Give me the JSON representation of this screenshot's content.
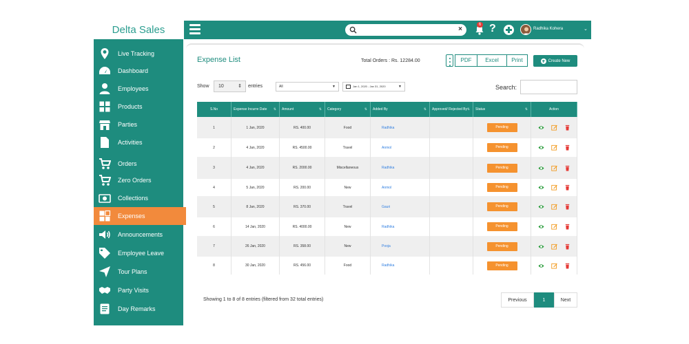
{
  "brand": "Delta Sales",
  "sidebar": {
    "items": [
      {
        "label": "Live Tracking",
        "icon": "location-pin-icon"
      },
      {
        "label": "Dashboard",
        "icon": "speedometer-icon"
      },
      {
        "label": "Employees",
        "icon": "person-icon"
      },
      {
        "label": "Products",
        "icon": "grid-icon"
      },
      {
        "label": "Parties",
        "icon": "store-icon"
      },
      {
        "label": "Activities",
        "icon": "document-icon"
      },
      {
        "label": "Orders",
        "icon": "cart-icon"
      },
      {
        "label": "Zero Orders",
        "icon": "cart-icon"
      },
      {
        "label": "Collections",
        "icon": "money-icon"
      },
      {
        "label": "Expenses",
        "icon": "expenses-icon",
        "active": true
      },
      {
        "label": "Announcements",
        "icon": "megaphone-icon"
      },
      {
        "label": "Employee Leave",
        "icon": "tag-icon"
      },
      {
        "label": "Tour Plans",
        "icon": "paper-plane-icon"
      },
      {
        "label": "Party Visits",
        "icon": "handshake-icon"
      },
      {
        "label": "Day Remarks",
        "icon": "notepad-icon"
      }
    ]
  },
  "topbar": {
    "search_placeholder": "",
    "notification_count": "6",
    "help_icon": "?",
    "user_name": "Radhika Kohera",
    "clear_search": "×"
  },
  "main": {
    "title": "Expense List",
    "total_orders": "Total Orders : Rs. 12284.00",
    "export_buttons": [
      "PDF",
      "Excel",
      "Print"
    ],
    "create_label": "Create New",
    "show_label": "Show",
    "show_value": "10",
    "entries_label": "entries",
    "category_filter": "All",
    "date_filter": "Jan 1, 2020 - Jan 31, 2020",
    "search_label": "Search:"
  },
  "table": {
    "columns": [
      "S.No",
      "Expense Incurre Date",
      "Amount",
      "Category",
      "Added By",
      "Approved/ Rejected By",
      "Status",
      "Action"
    ],
    "rows": [
      {
        "sno": "1",
        "date": "1 Jan, 2020",
        "amount": "RS. 400.00",
        "category": "Food",
        "added_by": "Radhika",
        "approved_by": "",
        "status": "Pending"
      },
      {
        "sno": "2",
        "date": "4 Jan, 2020",
        "amount": "RS. 4500.00",
        "category": "Travel",
        "added_by": "Anmol",
        "approved_by": "",
        "status": "Pending"
      },
      {
        "sno": "3",
        "date": "4 Jan, 2020",
        "amount": "RS. 2000.00",
        "category": "Miscellaneous",
        "added_by": "Radhika",
        "approved_by": "",
        "status": "Pending"
      },
      {
        "sno": "4",
        "date": "5 Jan, 2020",
        "amount": "RS. 200.00",
        "category": "New",
        "added_by": "Anmol",
        "approved_by": "",
        "status": "Pending"
      },
      {
        "sno": "5",
        "date": "8 Jan, 2020",
        "amount": "RS. 370.00",
        "category": "Travel",
        "added_by": "Gauri",
        "approved_by": "",
        "status": "Pending"
      },
      {
        "sno": "6",
        "date": "14 Jan, 2020",
        "amount": "RS. 4000.00",
        "category": "New",
        "added_by": "Radhika",
        "approved_by": "",
        "status": "Pending"
      },
      {
        "sno": "7",
        "date": "26 Jan, 2020",
        "amount": "RS. 358.00",
        "category": "New",
        "added_by": "Pooja",
        "approved_by": "",
        "status": "Pending"
      },
      {
        "sno": "8",
        "date": "30 Jan, 2020",
        "amount": "RS. 456.00",
        "category": "Food",
        "added_by": "Radhika",
        "approved_by": "",
        "status": "Pending"
      }
    ]
  },
  "footer": {
    "showing": "Showing 1 to 8 of 8 entries (filtered from 32 total entries)",
    "previous": "Previous",
    "page": "1",
    "next": "Next"
  },
  "colors": {
    "brand_teal": "#1e8c7e",
    "active_orange": "#f28a3c",
    "pending_orange": "#f5922f",
    "link_blue": "#2f7ee0",
    "view_green": "#2e9e3f",
    "edit_orange": "#f29a1f",
    "delete_red": "#e53935"
  }
}
